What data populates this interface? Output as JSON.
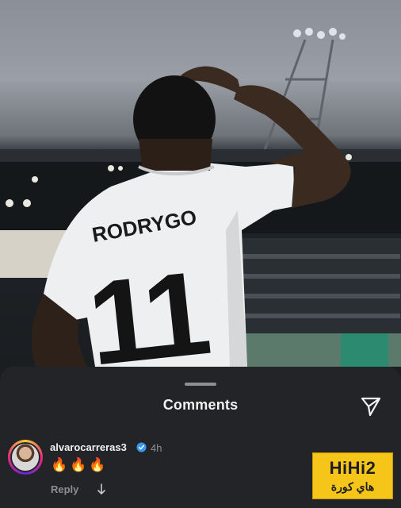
{
  "post": {
    "jersey_name": "RODRYGO",
    "jersey_number": "11"
  },
  "comments_sheet": {
    "title": "Comments",
    "share_icon": "paper-plane-icon"
  },
  "comments": [
    {
      "username": "alvarocarreras3",
      "verified": true,
      "time": "4h",
      "text": "🔥🔥🔥",
      "reply_label": "Reply"
    }
  ],
  "watermark": {
    "top": "HiHi2",
    "bottom": "هاي كورة"
  },
  "colors": {
    "sheet_background": "#232427",
    "verified_blue": "#3897f0",
    "logo_yellow": "#f6c51a"
  }
}
